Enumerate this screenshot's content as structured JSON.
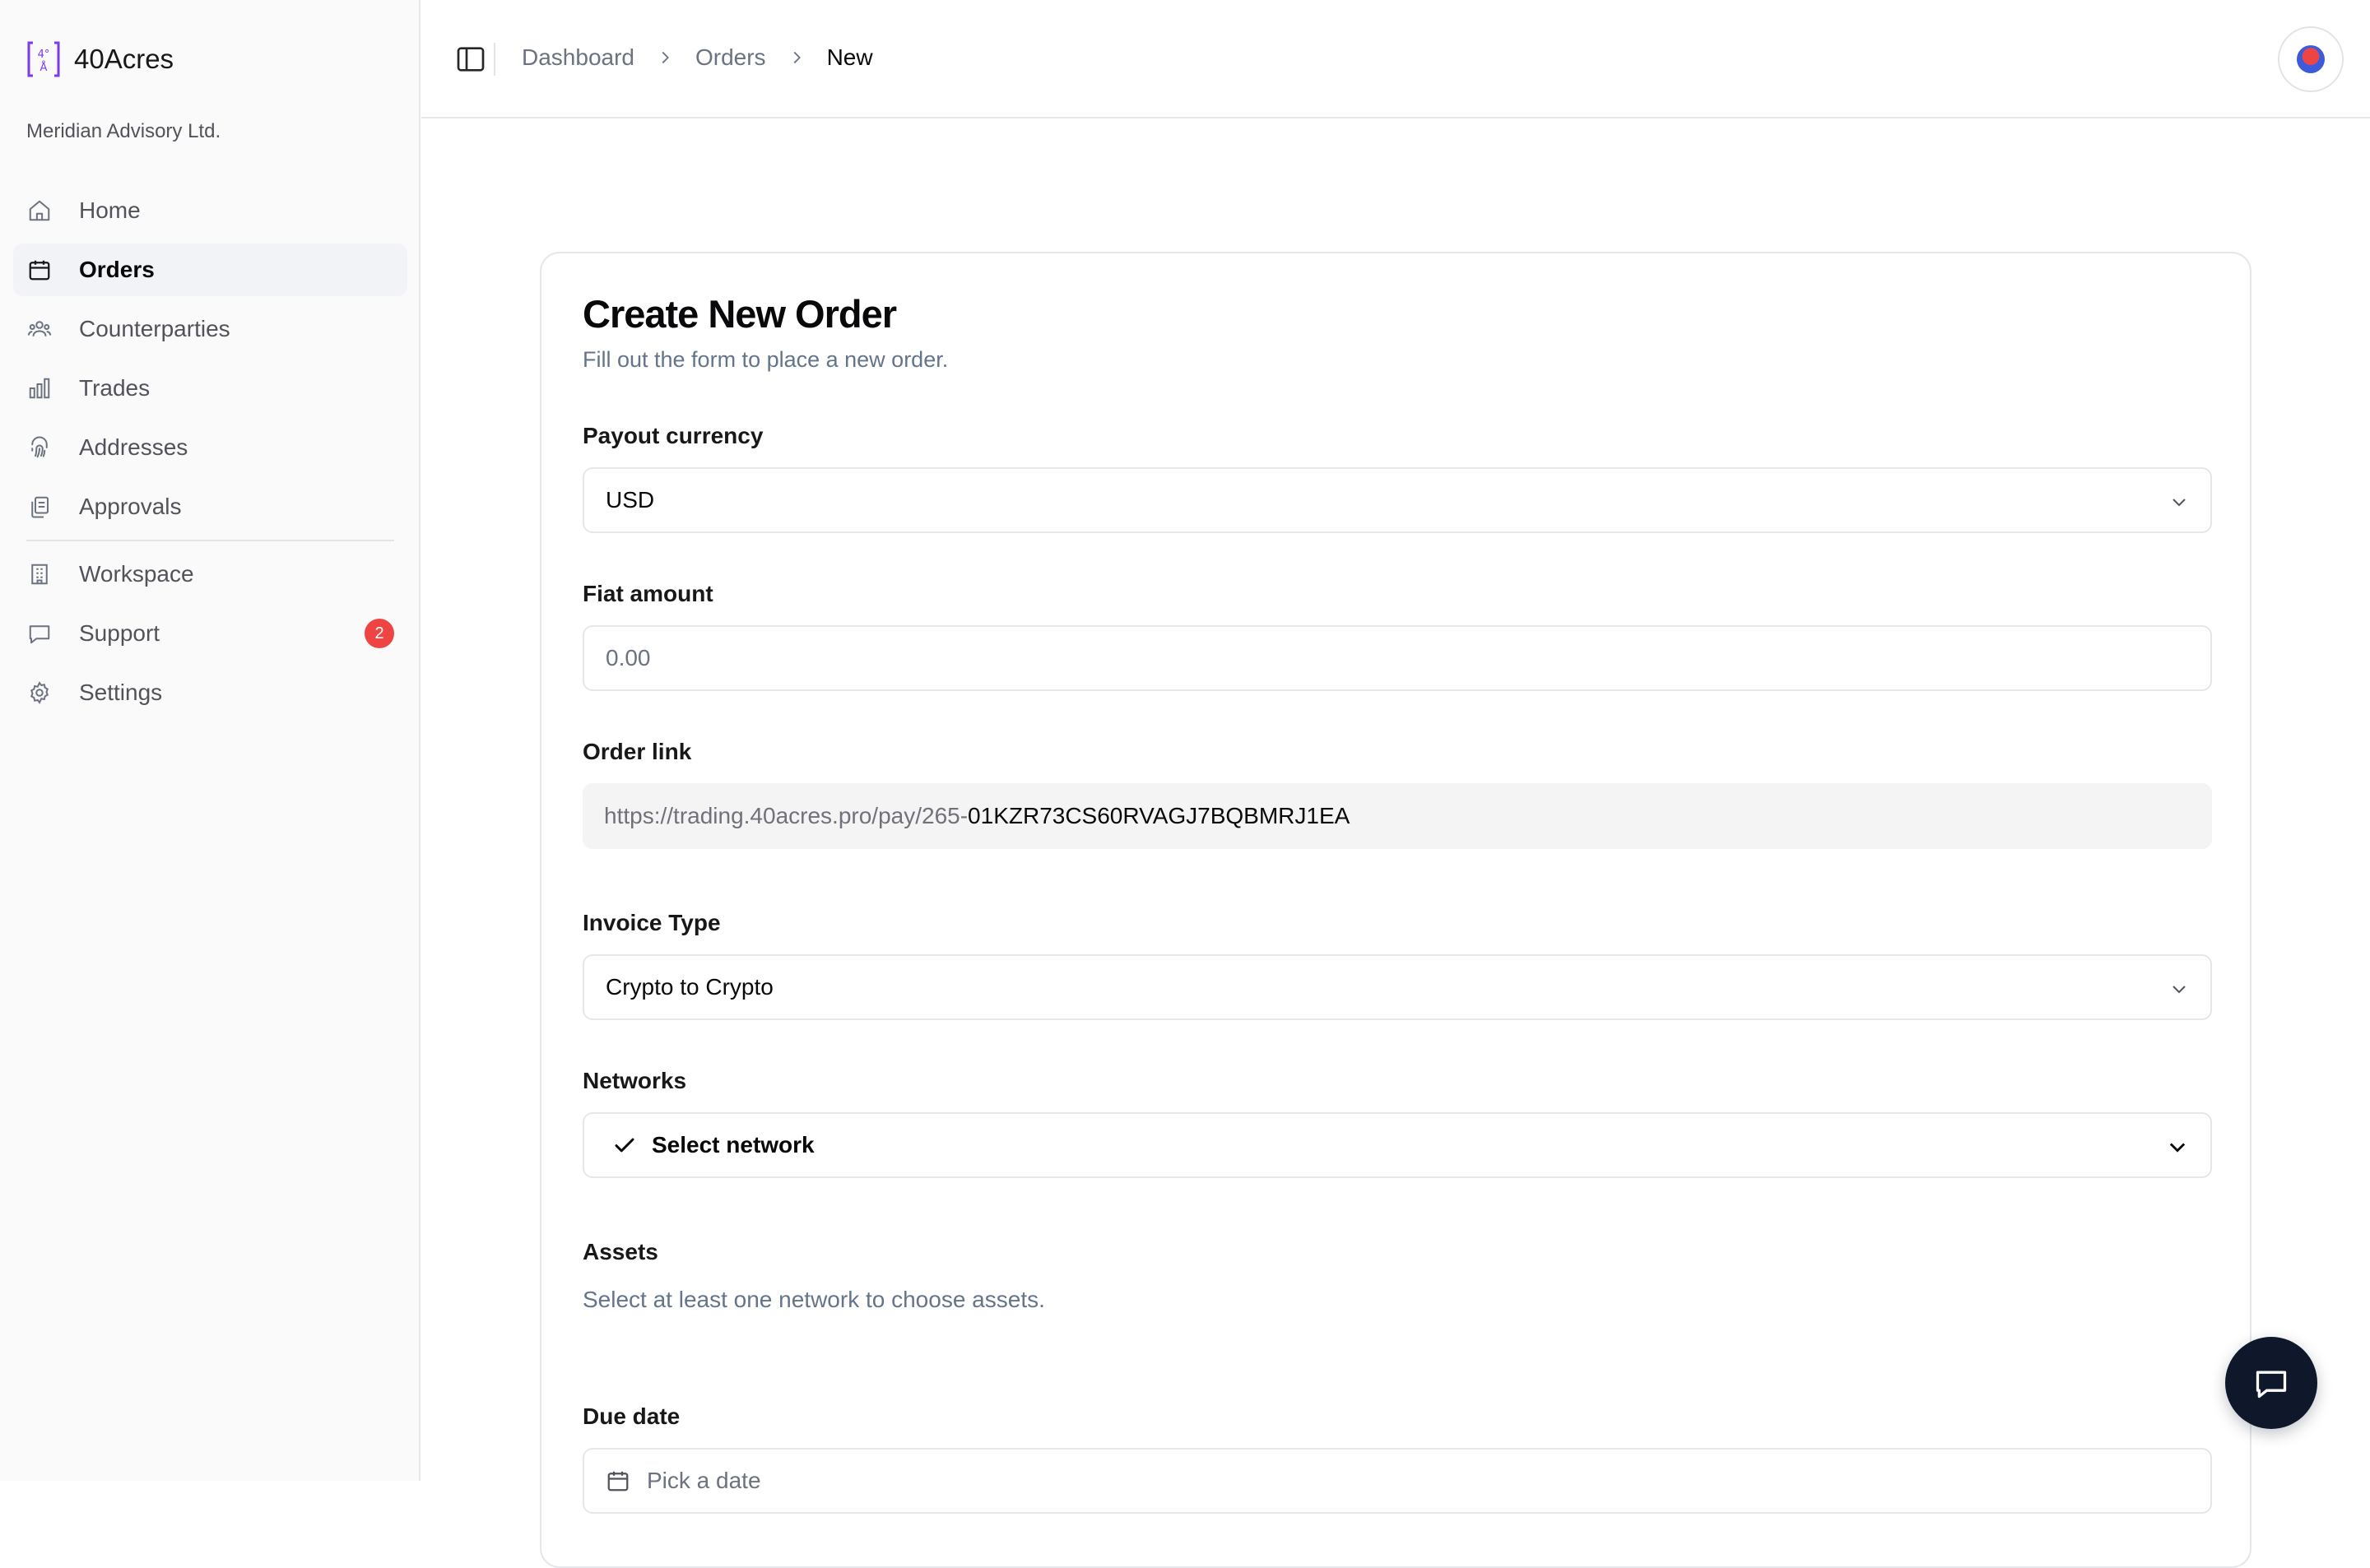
{
  "brand": {
    "name": "40Acres",
    "org": "Meridian Advisory Ltd."
  },
  "sidebar": {
    "items": [
      {
        "label": "Home",
        "icon": "home-icon",
        "active": false
      },
      {
        "label": "Orders",
        "icon": "calendar-icon",
        "active": true
      },
      {
        "label": "Counterparties",
        "icon": "users-icon",
        "active": false
      },
      {
        "label": "Trades",
        "icon": "bar-chart-icon",
        "active": false
      },
      {
        "label": "Addresses",
        "icon": "fingerprint-icon",
        "active": false
      },
      {
        "label": "Approvals",
        "icon": "clipboard-copy-icon",
        "active": false
      }
    ],
    "secondary": [
      {
        "label": "Workspace",
        "icon": "building-icon"
      },
      {
        "label": "Support",
        "icon": "message-icon",
        "badge": "2"
      },
      {
        "label": "Settings",
        "icon": "gear-icon"
      }
    ]
  },
  "header": {
    "breadcrumb": [
      "Dashboard",
      "Orders",
      "New"
    ]
  },
  "form": {
    "title": "Create New Order",
    "subtitle": "Fill out the form to place a new order.",
    "payout_currency": {
      "label": "Payout currency",
      "value": "USD"
    },
    "fiat_amount": {
      "label": "Fiat amount",
      "placeholder": "0.00"
    },
    "order_link": {
      "label": "Order link",
      "prefix": "https://trading.40acres.pro/pay/265-",
      "value": "01KZR73CS60RVAGJ7BQBMRJ1EA"
    },
    "invoice_type": {
      "label": "Invoice Type",
      "value": "Crypto to Crypto"
    },
    "networks": {
      "label": "Networks",
      "value": "Select network"
    },
    "assets": {
      "label": "Assets",
      "helper": "Select at least one network to choose assets."
    },
    "due_date": {
      "label": "Due date",
      "placeholder": "Pick a date"
    }
  },
  "colors": {
    "accent": "#7c3aed",
    "badge": "#ef4444",
    "fab": "#0f172a"
  }
}
